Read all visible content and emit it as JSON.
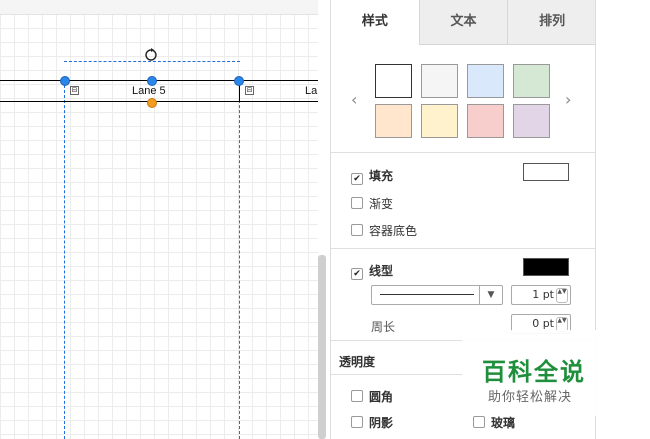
{
  "canvas": {
    "lanes": [
      {
        "label": "Lane 5",
        "collapse_symbol": "⊟"
      },
      {
        "label": "La",
        "collapse_symbol": "⊟"
      }
    ]
  },
  "panel": {
    "tabs": [
      {
        "label": "样式",
        "active": true
      },
      {
        "label": "文本",
        "active": false
      },
      {
        "label": "排列",
        "active": false
      }
    ],
    "swatch_colors": [
      "#ffffff",
      "#f5f5f5",
      "#dae8fc",
      "#d5e8d4",
      "#ffe6cc",
      "#fff2cc",
      "#f8cecc",
      "#e1d5e7"
    ],
    "swatch_prev": "‹",
    "swatch_next": "›",
    "fill": {
      "label": "填充",
      "checked": true,
      "color": "#ffffff"
    },
    "gradient": {
      "label": "渐变",
      "checked": false
    },
    "container_bg": {
      "label": "容器底色",
      "checked": false
    },
    "line": {
      "label": "线型",
      "checked": true,
      "color": "#000000",
      "width": "1 pt",
      "dropdown_arrow": "▼"
    },
    "perimeter": {
      "label": "周长",
      "value": "0 pt"
    },
    "opacity": {
      "label": "透明度"
    },
    "rounded": {
      "label": "圆角",
      "checked": false
    },
    "shadow": {
      "label": "阴影",
      "checked": false
    },
    "glass": {
      "label": "玻璃",
      "checked": false
    },
    "check_mark": "✔",
    "spin_symbol": "▲▼"
  },
  "watermark": {
    "title": "百科全说",
    "subtitle": "助你轻松解决"
  }
}
